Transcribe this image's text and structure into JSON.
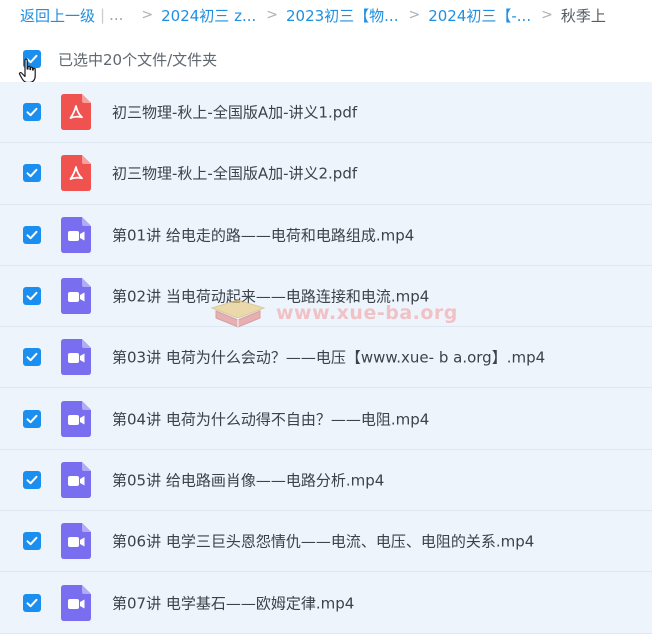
{
  "breadcrumb": {
    "back_label": "返回上一级",
    "separator": "|",
    "ellipsis": "...",
    "chevron": ">",
    "items": [
      {
        "label": "2024初三 z..."
      },
      {
        "label": "2023初三【物..."
      },
      {
        "label": "2024初三【-..."
      }
    ],
    "current": "秋季上"
  },
  "selection": {
    "label": "已选中20个文件/文件夹",
    "all_checked": true
  },
  "files": [
    {
      "name": "初三物理-秋上-全国版A加-讲义1.pdf",
      "type": "pdf",
      "checked": true
    },
    {
      "name": "初三物理-秋上-全国版A加-讲义2.pdf",
      "type": "pdf",
      "checked": true
    },
    {
      "name": "第01讲 给电走的路——电荷和电路组成.mp4",
      "type": "video",
      "checked": true
    },
    {
      "name": "第02讲 当电荷动起来——电路连接和电流.mp4",
      "type": "video",
      "checked": true
    },
    {
      "name": "第03讲 电荷为什么会动？——电压【www.xue- b a.org】.mp4",
      "type": "video",
      "checked": true
    },
    {
      "name": "第04讲 电荷为什么动得不自由？——电阻.mp4",
      "type": "video",
      "checked": true
    },
    {
      "name": "第05讲 给电路画肖像——电路分析.mp4",
      "type": "video",
      "checked": true
    },
    {
      "name": "第06讲 电学三巨头恩怨情仇——电流、电压、电阻的关系.mp4",
      "type": "video",
      "checked": true
    },
    {
      "name": "第07讲 电学基石——欧姆定律.mp4",
      "type": "video",
      "checked": true
    }
  ],
  "watermark": {
    "text": "www.xue-ba.org"
  },
  "colors": {
    "link": "#1f8fe0",
    "checkbox": "#1a8ff0",
    "pdf_icon": "#f0524f",
    "video_icon": "#7a6ef0",
    "row_bg": "#eef4fb"
  },
  "icons": {
    "pdf": "pdf-file-icon",
    "video": "video-file-icon",
    "cursor": "hand-pointer-icon"
  }
}
